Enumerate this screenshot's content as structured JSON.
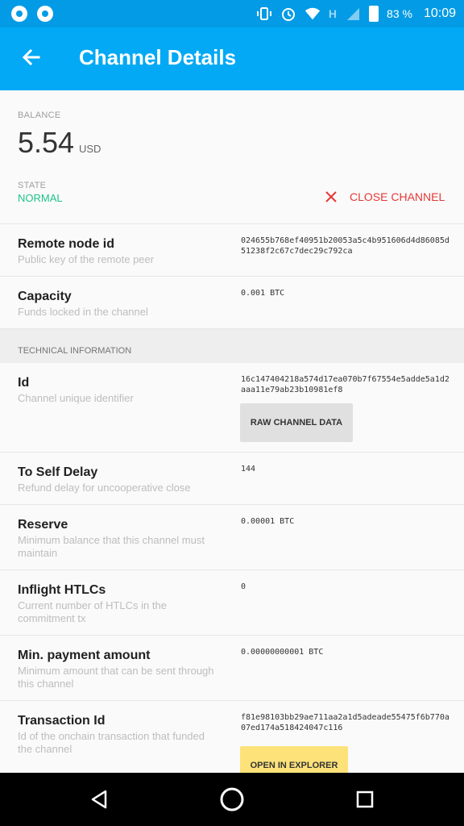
{
  "status_bar": {
    "battery_pct": "83 %",
    "time": "10:09",
    "network_letter": "H"
  },
  "app_bar": {
    "title": "Channel Details"
  },
  "balance": {
    "label": "BALANCE",
    "amount": "5.54",
    "unit": "USD"
  },
  "state": {
    "label": "STATE",
    "value": "NORMAL"
  },
  "close_channel": {
    "label": "CLOSE CHANNEL"
  },
  "rows_top": [
    {
      "title": "Remote node id",
      "desc": "Public key of the remote peer",
      "value": "024655b768ef40951b20053a5c4b951606d4d86085d51238f2c67c7dec29c792ca"
    },
    {
      "title": "Capacity",
      "desc": "Funds locked in the channel",
      "value": "0.001 BTC"
    }
  ],
  "technical_header": "TECHNICAL INFORMATION",
  "rows_tech": [
    {
      "title": "Id",
      "desc": "Channel unique identifier",
      "value": "16c147404218a574d17ea070b7f67554e5adde5a1d2aaa11e79ab23b10981ef8",
      "button": "RAW CHANNEL DATA"
    },
    {
      "title": "To Self Delay",
      "desc": "Refund delay for uncooperative close",
      "value": "144"
    },
    {
      "title": "Reserve",
      "desc": "Minimum balance that this channel must maintain",
      "value": "0.00001 BTC"
    },
    {
      "title": "Inflight HTLCs",
      "desc": "Current number of HTLCs in the commitment tx",
      "value": "0"
    },
    {
      "title": "Min. payment amount",
      "desc": "Minimum amount that can be sent through this channel",
      "value": "0.00000000001 BTC"
    },
    {
      "title": "Transaction Id",
      "desc": "Id of the onchain transaction that funded the channel",
      "value": "f81e98103bb29ae711aa2a1d5adeade55475f6b770a07ed174a518424047c116",
      "button": "OPEN IN EXPLORER"
    }
  ],
  "colors": {
    "status_bar": "#039be5",
    "app_bar": "#03a9f4",
    "state_normal": "#1ec28b",
    "close_red": "#e53935",
    "open_explorer_bg": "#fde27a"
  },
  "icons": {
    "back": "arrow-left-icon",
    "close": "close-x-icon",
    "nav_back": "triangle-back-icon",
    "nav_home": "circle-home-icon",
    "nav_recent": "square-recents-icon"
  }
}
